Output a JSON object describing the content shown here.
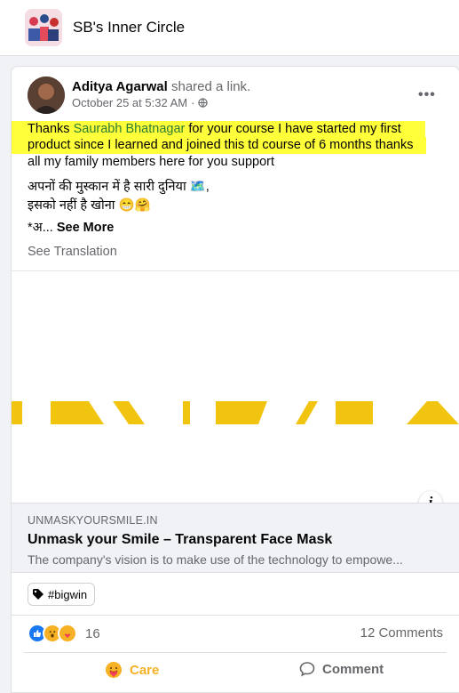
{
  "group": {
    "title": "SB's Inner Circle",
    "avatar_icon": "group-avatar"
  },
  "post": {
    "author": "Aditya Agarwal",
    "action": "shared a link.",
    "timestamp": "October 25 at 5:32 AM",
    "privacy_icon": "globe-icon",
    "more_label": "•••",
    "text": {
      "line1_before": "Thanks ",
      "mention": "Saurabh Bhatnagar",
      "line1_after": " for your course I have started my first",
      "line2": "product since I learned and joined this td course of 6 months thanks",
      "line3": "all my family members here for you support",
      "line4": "अपनों की मुस्कान में है सारी दुनिया 🗺️,",
      "line5": " इसको नहीं है खोना 😁🤗",
      "line6_prefix": "*अ...",
      "see_more": "See More"
    },
    "see_translation": "See Translation",
    "highlight_color": "#ffff3a",
    "mention_color": "#2e7d32"
  },
  "link": {
    "domain": "UNMASKYOURSMILE.IN",
    "title": "Unmask your Smile – Transparent Face Mask",
    "description": "The company's vision is to make use of the technology to empowe...",
    "info_label": "i",
    "stripe_color": "#f1c40f"
  },
  "hashtag": {
    "label": "#bigwin",
    "icon": "tag-icon"
  },
  "reactions": {
    "count": "16",
    "icons": [
      "like-icon",
      "wow-icon",
      "care-icon"
    ]
  },
  "comments": {
    "label": "12 Comments"
  },
  "actions": [
    {
      "label": "Care",
      "icon": "care-icon"
    },
    {
      "label": "Comment",
      "icon": "comment-icon"
    }
  ]
}
